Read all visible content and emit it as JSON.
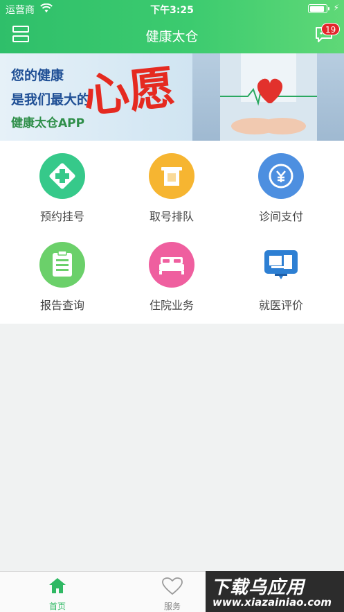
{
  "status_bar": {
    "carrier": "运营商",
    "time": "下午3:25"
  },
  "nav": {
    "title": "健康太仓",
    "badge_count": "19"
  },
  "banner": {
    "line1": "您的健康",
    "line2": "是我们最大的",
    "line3": "健康太仓APP",
    "brush_text": "心愿"
  },
  "grid": [
    {
      "label": "预约挂号",
      "icon": "medical-cross-icon",
      "color": "#36c98a"
    },
    {
      "label": "取号排队",
      "icon": "ticket-icon",
      "color": "#f6b531"
    },
    {
      "label": "诊间支付",
      "icon": "yuan-coin-icon",
      "color": "#4d8fe0"
    },
    {
      "label": "报告查询",
      "icon": "clipboard-icon",
      "color": "#6bd06a"
    },
    {
      "label": "住院业务",
      "icon": "bed-icon",
      "color": "#ef5f9f"
    },
    {
      "label": "就医评价",
      "icon": "monitor-review-icon",
      "color": "#2d7fd3"
    }
  ],
  "tabbar": {
    "tabs": [
      {
        "label": "首页",
        "icon": "home-icon",
        "active": true
      },
      {
        "label": "服务",
        "icon": "heart-icon",
        "active": false
      }
    ],
    "active_color": "#2fb863",
    "inactive_color": "#888888"
  },
  "watermark": {
    "top": "下载乌应用",
    "bottom": "www.xiazainiao.com"
  }
}
